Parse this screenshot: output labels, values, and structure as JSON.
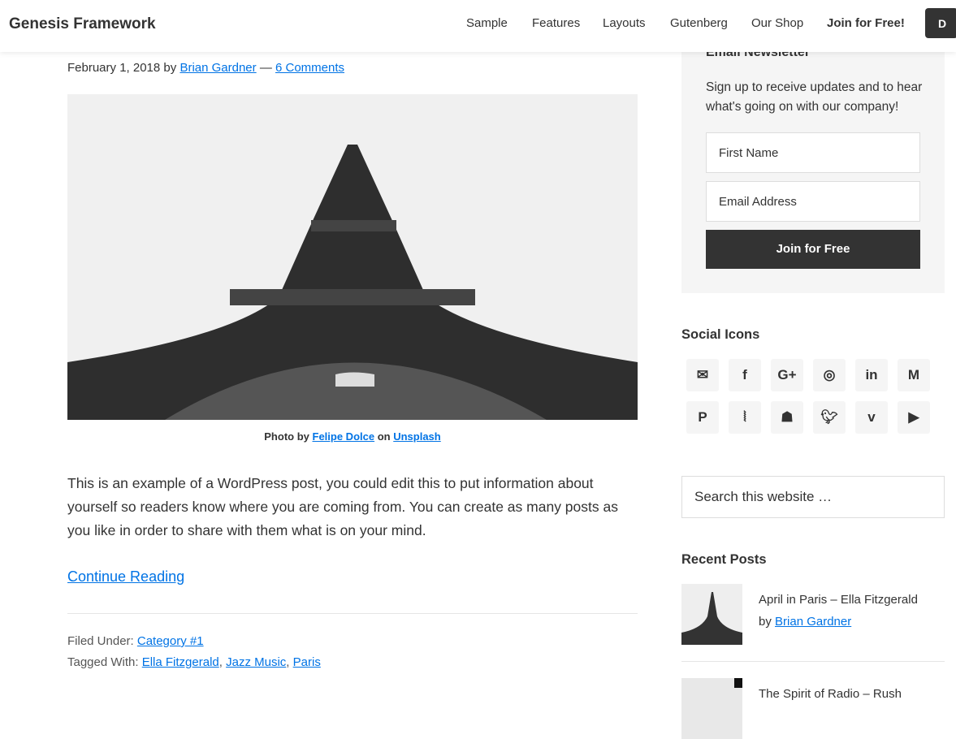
{
  "header": {
    "logo": "Genesis Framework",
    "nav": [
      "Sample",
      "Features",
      "Layouts",
      "Gutenberg",
      "Our Shop",
      "Join for Free!"
    ],
    "button": "D"
  },
  "post": {
    "date": "February 1, 2018",
    "by": "by",
    "author": "Brian Gardner",
    "dash": "—",
    "comments": "6 Comments",
    "caption": {
      "prefix": "Photo by",
      "photographer": "Felipe Dolce",
      "on": "on",
      "site": "Unsplash"
    },
    "body": "This is an example of a WordPress post, you could edit this to put information about yourself so readers know where you are coming from. You can create as many posts as you like in order to share with them what is on your mind.",
    "continue": "Continue Reading",
    "filed_label": "Filed Under:",
    "category": "Category #1",
    "tagged_label": "Tagged With:",
    "tags": [
      "Ella Fitzgerald",
      "Jazz Music",
      "Paris"
    ]
  },
  "newsletter": {
    "title": "Email Newsletter",
    "text": "Sign up to receive updates and to hear what's going on with our company!",
    "first_name": "First Name",
    "email": "Email Address",
    "button": "Join for Free"
  },
  "social": {
    "title": "Social Icons",
    "icons": [
      "email-icon",
      "facebook-icon",
      "google-plus-icon",
      "instagram-icon",
      "linkedin-icon",
      "medium-icon",
      "pinterest-icon",
      "rss-icon",
      "snapchat-icon",
      "twitter-icon",
      "vimeo-icon",
      "youtube-icon"
    ]
  },
  "search": {
    "placeholder": "Search this website …"
  },
  "recent": {
    "title": "Recent Posts",
    "posts": [
      {
        "title": "April in Paris – Ella Fitzgerald",
        "by": "by",
        "author": "Brian Gardner"
      },
      {
        "title": "The Spirit of Radio – Rush"
      }
    ]
  }
}
